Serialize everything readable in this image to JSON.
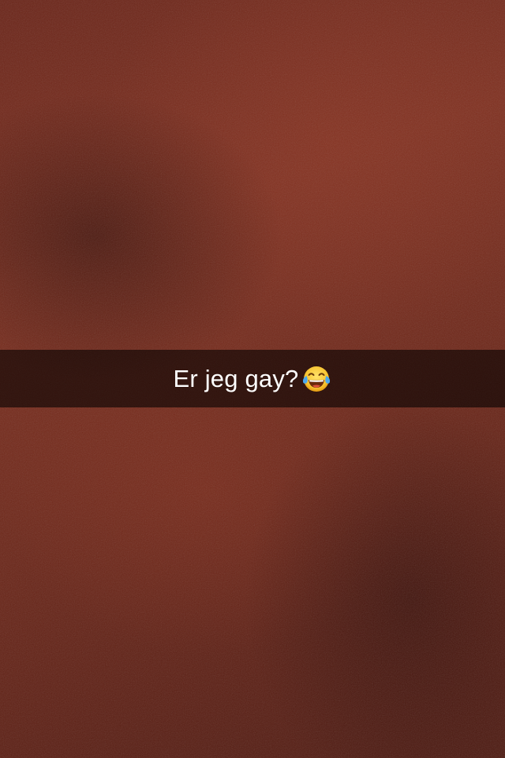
{
  "snap": {
    "caption": "Er jeg gay?",
    "caption_emoji": "face-with-tears-of-joy-icon"
  },
  "colors": {
    "background": "#6a2418",
    "caption_bar": "rgba(0,0,0,0.58)",
    "caption_text": "#ffffff"
  }
}
